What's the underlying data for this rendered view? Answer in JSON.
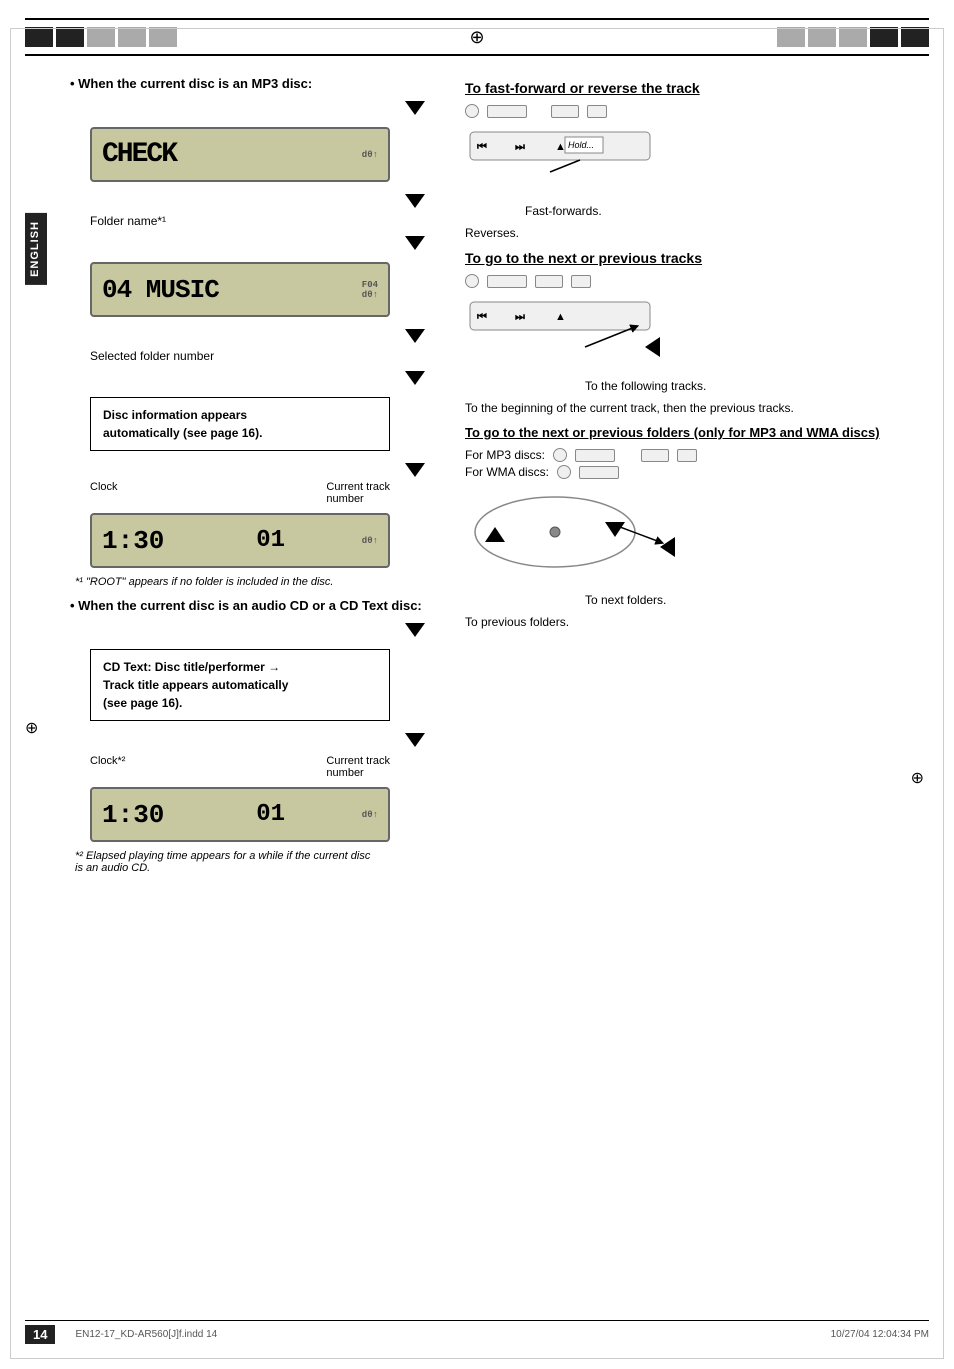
{
  "header": {
    "divider_symbol": "⊕"
  },
  "english_tab": "ENGLISH",
  "left": {
    "mp3_section_title": "• When the current disc is an MP3 disc:",
    "lcd1_text": "CHECK",
    "lcd1_sub": "dθ↑",
    "folder_label": "Folder name*¹",
    "lcd2_text": "04 MUSIC",
    "lcd2_sub": "F04",
    "lcd2_d": "dθ↑",
    "folder_num_label": "Selected folder number",
    "info_box1_line1": "Disc information appears",
    "info_box1_line2": "automatically (see page 16).",
    "clock_label": "Clock",
    "current_track_label": "Current track",
    "number_label": "number",
    "lcd3_time": "1:30",
    "lcd3_track": "01",
    "lcd3_d": "dθ↑",
    "footnote1": "*¹  \"ROOT\" appears if no folder is included in the disc.",
    "cd_section_title": "• When the current disc is an audio CD or a CD Text disc:",
    "info_box2_line1": "CD Text: Disc title/performer →",
    "info_box2_line2": "Track title appears automatically",
    "info_box2_line3": "(see page 16).",
    "clock2_label": "Clock*²",
    "current_track2_label": "Current track",
    "number2_label": "number",
    "lcd4_time": "1:30",
    "lcd4_track": "01",
    "lcd4_d": "dθ↑",
    "footnote2": "*²  Elapsed playing time appears for a while if the current disc is an audio CD."
  },
  "right": {
    "fast_forward_heading": "To fast-forward or reverse the track",
    "fast_forwards_label": "Fast-forwards.",
    "hold_label": "Hold...",
    "reverses_label": "Reverses.",
    "next_prev_heading": "To go to the next or previous tracks",
    "following_tracks_label": "To the following tracks.",
    "prev_tracks_desc": "To the beginning of the current track, then the previous tracks.",
    "next_prev_folders_heading": "To go to the next or previous folders (only for MP3 and WMA discs)",
    "for_mp3_label": "For MP3 discs:",
    "for_wma_label": "For WMA discs:",
    "next_folders_label": "To next folders.",
    "prev_folders_label": "To previous folders."
  },
  "footer": {
    "page_number": "14",
    "filename": "EN12-17_KD-AR560[J]f.indd  14",
    "date": "10/27/04  12:04:34 PM"
  }
}
